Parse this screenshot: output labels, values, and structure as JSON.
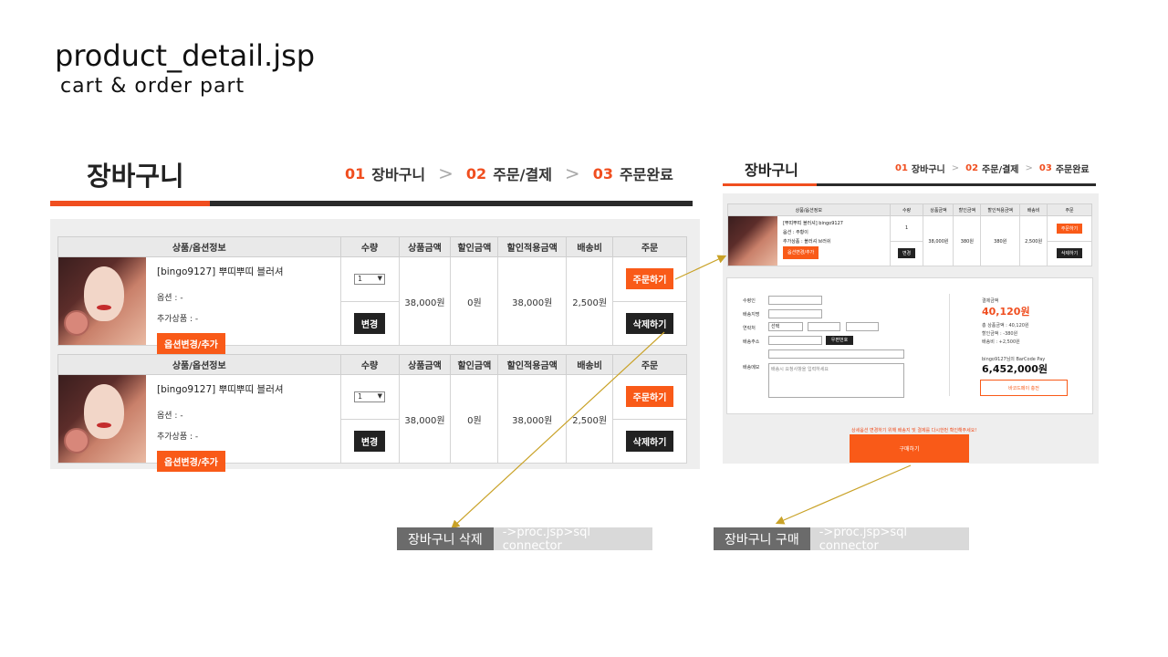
{
  "slide": {
    "title": "product_detail.jsp",
    "subtitle": "cart  &  order  part"
  },
  "cart": {
    "title": "장바구니",
    "steps": [
      {
        "num": "01",
        "label": "장바구니"
      },
      {
        "num": "02",
        "label": "주문/결제"
      },
      {
        "num": "03",
        "label": "주문완료"
      }
    ],
    "headers": [
      "상품/옵션정보",
      "수량",
      "상품금액",
      "할인금액",
      "할인적용금액",
      "배송비",
      "주문"
    ],
    "rows": [
      {
        "name": "[bingo9127] 뿌띠뿌띠 블러셔",
        "option": "옵션 : -",
        "addon": "추가상품 : -",
        "option_btn": "옵션변경/추가",
        "qty": "1",
        "change_btn": "변경",
        "price": "38,000원",
        "discount": "0원",
        "final": "38,000원",
        "ship": "2,500원",
        "order_btn": "주문하기",
        "delete_btn": "삭제하기"
      },
      {
        "name": "[bingo9127] 뿌띠뿌띠 블러셔",
        "option": "옵션 : -",
        "addon": "추가상품 : -",
        "option_btn": "옵션변경/추가",
        "qty": "1",
        "change_btn": "변경",
        "price": "38,000원",
        "discount": "0원",
        "final": "38,000원",
        "ship": "2,500원",
        "order_btn": "주문하기",
        "delete_btn": "삭제하기"
      }
    ]
  },
  "mini": {
    "title": "장바구니",
    "steps": [
      {
        "num": "01",
        "label": "장바구니"
      },
      {
        "num": "02",
        "label": "주문/결제"
      },
      {
        "num": "03",
        "label": "주문완료"
      }
    ],
    "headers": [
      "상품/옵션정보",
      "수량",
      "상품금액",
      "할인금액",
      "할인적용금액",
      "배송비",
      "주문"
    ],
    "row": {
      "name": "[뿌띠뿌띠 블러셔] bingo9127",
      "option": "옵션 : 주황이",
      "addon": "추가상품 : 블러셔 브러쉬",
      "option_btn": "옵션변경/추가",
      "qty": "1",
      "change_btn": "변경",
      "price": "38,000원",
      "discount": "380원",
      "final": "380원",
      "ship": "2,500원",
      "order_btn": "주문하기",
      "delete_btn": "삭제하기"
    },
    "form": {
      "receiver": "수령인",
      "receiver2": "배송지명",
      "phone": "연락처",
      "phone_select": "선택",
      "address": "배송주소",
      "zip_btn": "우편번호",
      "memo": "배송메모",
      "memo_placeholder": "배송시 요청사항을 입력하세요"
    },
    "pay": {
      "label": "결제금액",
      "amount": "40,120원",
      "total_line": "총 상품금액 : 40,120원",
      "discount_line": "할인금액 : -380원",
      "ship_line": "배송비 : +2,500원",
      "balance_label": "bingo9127님의 BarCode Pay",
      "balance": "6,452,000원",
      "charge_btn": "바코드페이 충전"
    },
    "notice": "상세옵션 변경하기 위해 배송지 및 결제를 다시한번 확인해주세요!",
    "buy_btn": "구매하기"
  },
  "tags": [
    {
      "main": "장바구니 삭제",
      "side": "->proc.jsp>sql  connector"
    },
    {
      "main": "장바구니 구매",
      "side": "->proc.jsp>sql  connector"
    }
  ]
}
